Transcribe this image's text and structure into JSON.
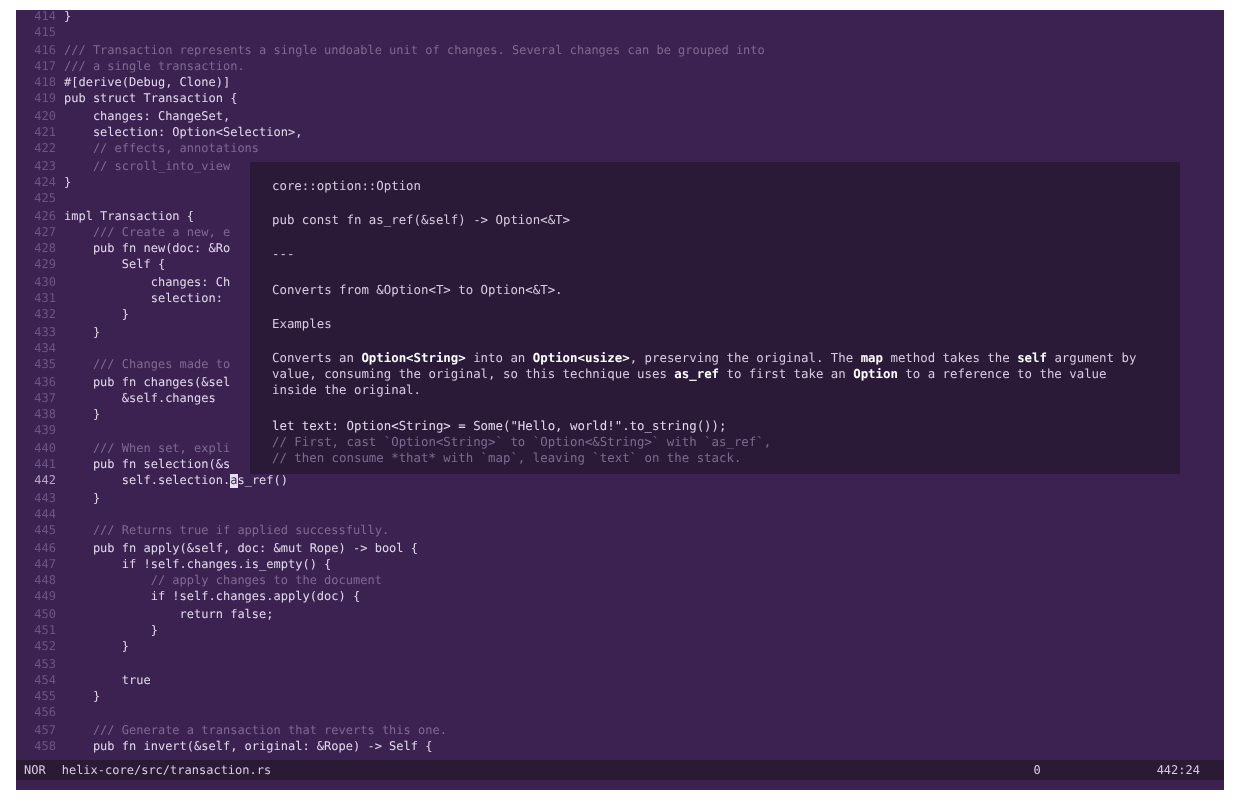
{
  "editor": {
    "lines": [
      {
        "number": "414",
        "kind": "code",
        "text": "}"
      },
      {
        "number": "415"
      },
      {
        "number": "416",
        "kind": "comment",
        "text": "/// Transaction represents a single undoable unit of changes. Several changes can be grouped into"
      },
      {
        "number": "417",
        "kind": "comment",
        "text": "/// a single transaction."
      },
      {
        "number": "418",
        "kind": "code",
        "text": "#[derive(Debug, Clone)]"
      },
      {
        "number": "419",
        "kind": "code",
        "text": "pub struct Transaction {"
      },
      {
        "number": "420",
        "kind": "code",
        "text": "    changes: ChangeSet,"
      },
      {
        "number": "421",
        "kind": "code",
        "text": "    selection: Option<Selection>,"
      },
      {
        "number": "422",
        "kind": "comment",
        "text": "    // effects, annotations"
      },
      {
        "number": "423",
        "kind": "comment",
        "text": "    // scroll_into_view"
      },
      {
        "number": "424",
        "kind": "code",
        "text": "}"
      },
      {
        "number": "425"
      },
      {
        "number": "426",
        "kind": "code",
        "text": "impl Transaction {"
      },
      {
        "number": "427",
        "kind": "comment",
        "text": "    /// Create a new, e"
      },
      {
        "number": "428",
        "kind": "code",
        "text": "    pub fn new(doc: &Ro"
      },
      {
        "number": "429",
        "kind": "code",
        "text": "        Self {"
      },
      {
        "number": "430",
        "kind": "code",
        "text": "            changes: Ch"
      },
      {
        "number": "431",
        "kind": "code",
        "text": "            selection:"
      },
      {
        "number": "432",
        "kind": "code",
        "text": "        }"
      },
      {
        "number": "433",
        "kind": "code",
        "text": "    }"
      },
      {
        "number": "434"
      },
      {
        "number": "435",
        "kind": "comment",
        "text": "    /// Changes made to"
      },
      {
        "number": "436",
        "kind": "code",
        "text": "    pub fn changes(&sel"
      },
      {
        "number": "437",
        "kind": "code",
        "text": "        &self.changes"
      },
      {
        "number": "438",
        "kind": "code",
        "text": "    }"
      },
      {
        "number": "439"
      },
      {
        "number": "440",
        "kind": "comment",
        "text": "    /// When set, expli"
      },
      {
        "number": "441",
        "kind": "code",
        "text": "    pub fn selection(&s"
      },
      {
        "number": "442",
        "kind": "cursor",
        "text": "        self.selection.",
        "cursor": "a",
        "after": "s_ref()"
      },
      {
        "number": "443",
        "kind": "code",
        "text": "    }"
      },
      {
        "number": "444"
      },
      {
        "number": "445",
        "kind": "comment",
        "text": "    /// Returns true if applied successfully."
      },
      {
        "number": "446",
        "kind": "code",
        "text": "    pub fn apply(&self, doc: &mut Rope) -> bool {"
      },
      {
        "number": "447",
        "kind": "code",
        "text": "        if !self.changes.is_empty() {"
      },
      {
        "number": "448",
        "kind": "comment",
        "text": "            // apply changes to the document"
      },
      {
        "number": "449",
        "kind": "code",
        "text": "            if !self.changes.apply(doc) {"
      },
      {
        "number": "450",
        "kind": "code",
        "text": "                return false;"
      },
      {
        "number": "451",
        "kind": "code",
        "text": "            }"
      },
      {
        "number": "452",
        "kind": "code",
        "text": "        }"
      },
      {
        "number": "453"
      },
      {
        "number": "454",
        "kind": "code",
        "text": "        true"
      },
      {
        "number": "455",
        "kind": "code",
        "text": "    }"
      },
      {
        "number": "456"
      },
      {
        "number": "457",
        "kind": "comment",
        "text": "    /// Generate a transaction that reverts this one."
      },
      {
        "number": "458",
        "kind": "code",
        "text": "    pub fn invert(&self, original: &Rope) -> Self {"
      }
    ]
  },
  "hover_popup": {
    "blocks": [
      {
        "kind": "text",
        "lines": [
          "core::option::Option"
        ]
      },
      {
        "kind": "text",
        "lines": [
          "pub const fn as_ref(&self) -> Option<&T>"
        ]
      },
      {
        "kind": "text",
        "lines": [
          "---"
        ]
      },
      {
        "kind": "text",
        "lines": [
          "Converts from &Option<T> to Option<&T>."
        ]
      },
      {
        "kind": "text",
        "lines": [
          "Examples"
        ]
      },
      {
        "kind": "text",
        "lines": [
          "Converts an **Option<String>** into an **Option<usize>**, preserving the original. The **map** method takes the **self** argument by",
          "value, consuming the original, so this technique uses **as_ref** to first take an **Option** to a reference to the value",
          "inside the original."
        ]
      },
      {
        "kind": "code",
        "lines": [
          "let text: Option<String> = Some(\"Hello, world!\".to_string());",
          "// First, cast `Option<String>` to `Option<&String>` with `as_ref`,",
          "// then consume *that* with `map`, leaving `text` on the stack."
        ]
      }
    ]
  },
  "status_bar": {
    "mode": "NOR",
    "file": "helix-core/src/transaction.rs",
    "column_3": "0",
    "position": "442:24"
  }
}
